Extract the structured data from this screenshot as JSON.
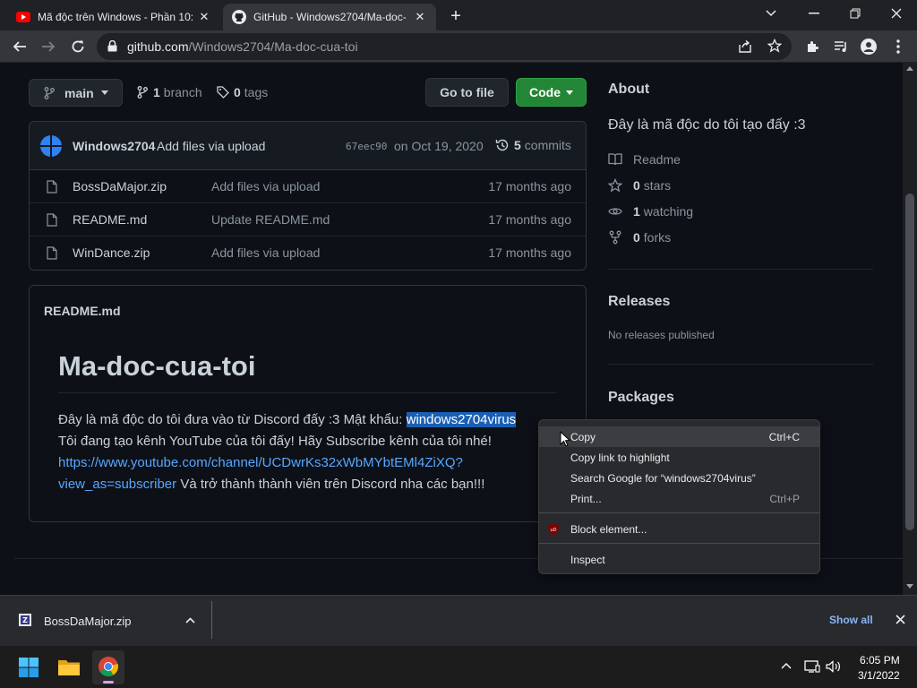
{
  "browser": {
    "tabs": [
      {
        "title": "Mã độc trên Windows - Phần 10:",
        "icon": "youtube-icon"
      },
      {
        "title": "GitHub - Windows2704/Ma-doc-",
        "icon": "github-icon",
        "active": true
      }
    ],
    "url_host": "github.com",
    "url_path": "/Windows2704/Ma-doc-cua-toi"
  },
  "repo": {
    "branch": "main",
    "branches_count": "1",
    "branches_label": "branch",
    "tags_count": "0",
    "tags_label": "tags",
    "goto_file": "Go to file",
    "code_button": "Code",
    "commit": {
      "author": "Windows2704",
      "message": "Add files via upload",
      "hash": "67eec90",
      "date": "on Oct 19, 2020",
      "commits_count": "5",
      "commits_label": "commits"
    },
    "files": [
      {
        "name": "BossDaMajor.zip",
        "message": "Add files via upload",
        "age": "17 months ago"
      },
      {
        "name": "README.md",
        "message": "Update README.md",
        "age": "17 months ago"
      },
      {
        "name": "WinDance.zip",
        "message": "Add files via upload",
        "age": "17 months ago"
      }
    ]
  },
  "readme": {
    "label": "README.md",
    "heading": "Ma-doc-cua-toi",
    "line1_before": "Đây là mã độc do tôi đưa vào từ Discord đấy :3 Mật khẩu: ",
    "line1_selected": "windows2704virus",
    "line2": "Tôi đang tạo kênh YouTube của tôi đấy! Hãy Subscribe kênh của tôi nhé!",
    "link_line1": "https://www.youtube.com/channel/UCDwrKs32xWbMYbtEMl4ZiXQ?",
    "link_line2": "view_as=subscriber",
    "line3_after": " Và trở thành thành viên trên Discord nha các bạn!!!"
  },
  "about": {
    "heading": "About",
    "description": "Đây là mã độc do tôi tạo đấy :3",
    "readme": "Readme",
    "stars_count": "0",
    "stars_label": "stars",
    "watching_count": "1",
    "watching_label": "watching",
    "forks_count": "0",
    "forks_label": "forks",
    "releases_heading": "Releases",
    "releases_text": "No releases published",
    "packages_heading": "Packages"
  },
  "context_menu": {
    "items": [
      {
        "label": "Copy",
        "shortcut": "Ctrl+C"
      },
      {
        "label": "Copy link to highlight",
        "shortcut": ""
      },
      {
        "label": "Search Google for “windows2704virus”",
        "shortcut": ""
      },
      {
        "label": "Print...",
        "shortcut": "Ctrl+P"
      },
      {
        "label": "Block element...",
        "shortcut": ""
      },
      {
        "label": "Inspect",
        "shortcut": ""
      }
    ]
  },
  "downloads": {
    "file": "BossDaMajor.zip",
    "show_all": "Show all"
  },
  "taskbar": {
    "time": "6:05 PM",
    "date": "3/1/2022"
  },
  "colors": {
    "green": "#238636",
    "link": "#58a6ff",
    "selection": "#1a5fb4"
  }
}
